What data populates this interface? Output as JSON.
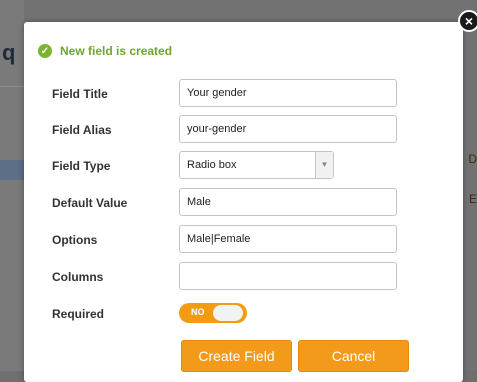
{
  "background": {
    "left_glyph": "q",
    "right_text_1": "D",
    "right_text_2": "E"
  },
  "close_icon": "×",
  "success_message": "New field is created",
  "form": {
    "field_title": {
      "label": "Field Title",
      "value": "Your gender"
    },
    "field_alias": {
      "label": "Field Alias",
      "value": "your-gender"
    },
    "field_type": {
      "label": "Field Type",
      "value": "Radio box"
    },
    "default_value": {
      "label": "Default Value",
      "value": "Male"
    },
    "options": {
      "label": "Options",
      "value": "Male|Female"
    },
    "columns": {
      "label": "Columns",
      "value": ""
    },
    "required": {
      "label": "Required",
      "toggle_text": "NO",
      "state": false
    }
  },
  "buttons": {
    "create": "Create Field",
    "cancel": "Cancel"
  },
  "colors": {
    "accent": "#f39a1a",
    "success": "#6da82a"
  }
}
